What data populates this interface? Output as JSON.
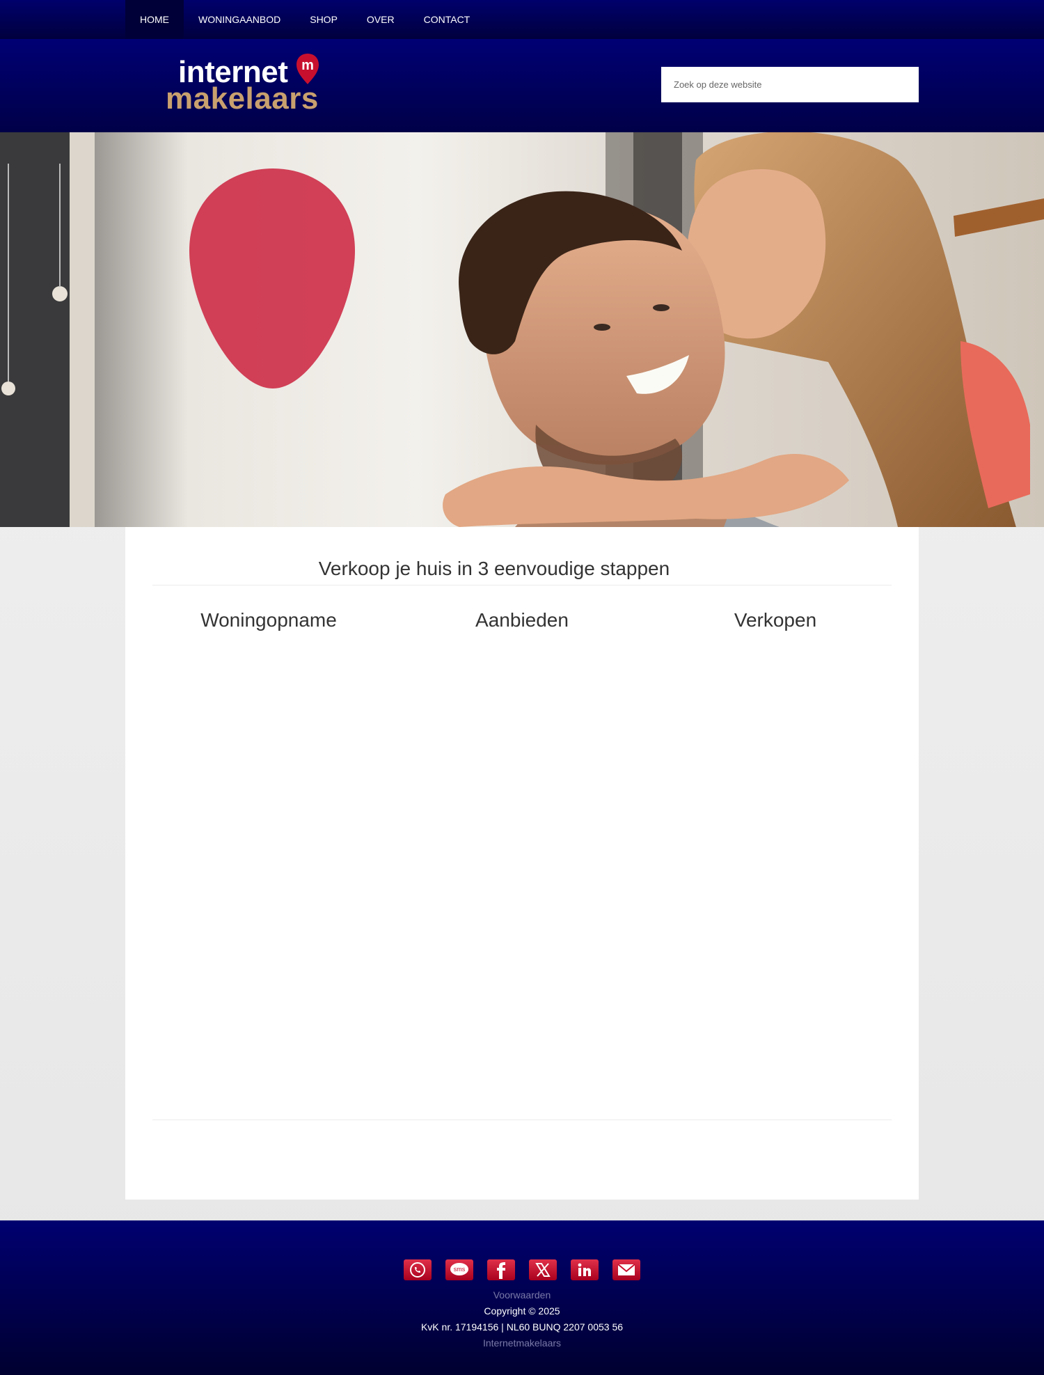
{
  "nav": {
    "items": [
      {
        "label": "HOME"
      },
      {
        "label": "WONINGAANBOD"
      },
      {
        "label": "SHOP"
      },
      {
        "label": "OVER"
      },
      {
        "label": "CONTACT"
      }
    ],
    "active": "HOME"
  },
  "header": {
    "logo": {
      "line1": "internet",
      "line2": "makelaars",
      "pin_letter": "m"
    },
    "search": {
      "placeholder": "Zoek op deze website",
      "value": ""
    }
  },
  "main": {
    "title": "Verkoop je huis in 3 eenvoudige stappen",
    "steps": [
      {
        "label": "Woningopname"
      },
      {
        "label": "Aanbieden"
      },
      {
        "label": "Verkopen"
      }
    ]
  },
  "footer": {
    "social": [
      {
        "icon": "whatsapp-icon"
      },
      {
        "icon": "sms-icon",
        "label": "sms"
      },
      {
        "icon": "facebook-icon"
      },
      {
        "icon": "x-icon"
      },
      {
        "icon": "linkedin-icon"
      },
      {
        "icon": "mail-icon"
      }
    ],
    "terms_link": "Voorwaarden",
    "copyright": "Copyright © 2025",
    "kvk": "KvK nr. 17194156 | NL60 BUNQ 2207 0053 56",
    "brand_link": "Internetmakelaars"
  },
  "colors": {
    "nav_bg": "#00006c",
    "brand_red": "#c83a4e",
    "brand_gold": "#c8a06e"
  }
}
